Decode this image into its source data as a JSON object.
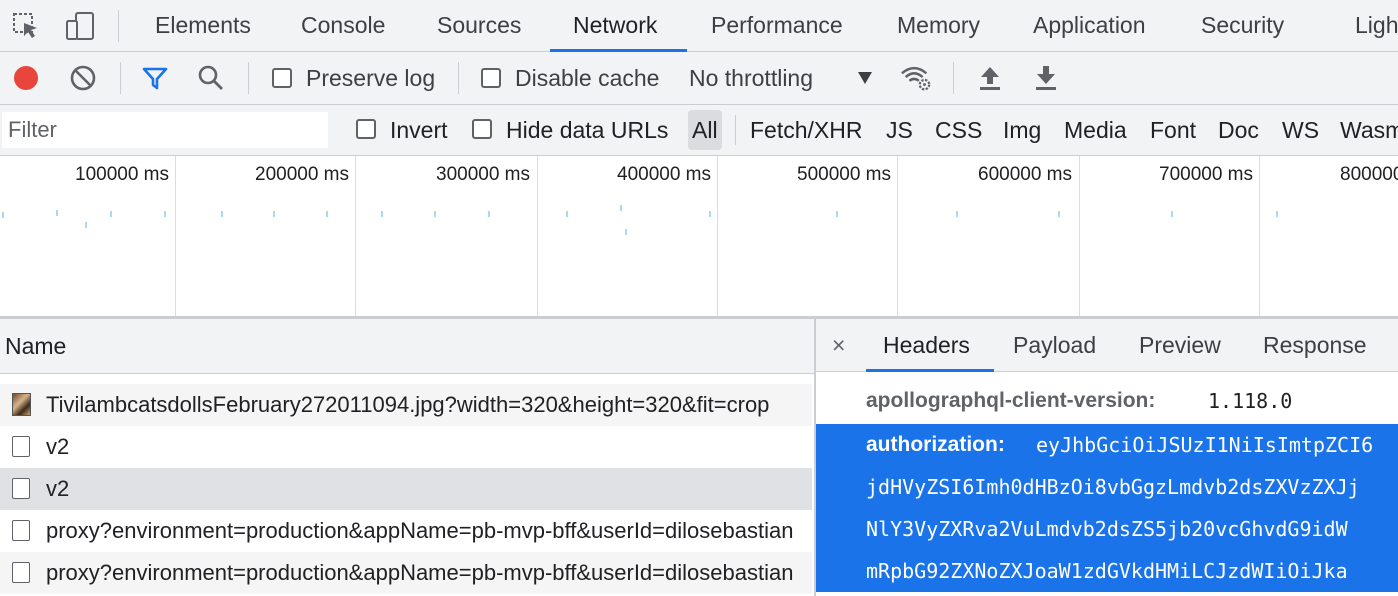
{
  "main_tabs": [
    "Elements",
    "Console",
    "Sources",
    "Network",
    "Performance",
    "Memory",
    "Application",
    "Security",
    "Ligh"
  ],
  "active_main_tab": "Network",
  "toolbar": {
    "preserve_log": "Preserve log",
    "disable_cache": "Disable cache",
    "throttling": "No throttling"
  },
  "filter_bar": {
    "placeholder": "Filter",
    "invert": "Invert",
    "hide_data_urls": "Hide data URLs",
    "types": [
      "All",
      "Fetch/XHR",
      "JS",
      "CSS",
      "Img",
      "Media",
      "Font",
      "Doc",
      "WS",
      "Wasm"
    ],
    "active_type": "All"
  },
  "overview": {
    "labels": [
      "100000 ms",
      "200000 ms",
      "300000 ms",
      "400000 ms",
      "500000 ms",
      "600000 ms",
      "700000 ms",
      "800000"
    ]
  },
  "list": {
    "header": "Name",
    "rows": [
      "TivilambcatsdollsFebruary272011094.jpg?width=320&height=320&fit=crop",
      "v2",
      "v2",
      "proxy?environment=production&appName=pb-mvp-bff&userId=dilosebastian",
      "proxy?environment=production&appName=pb-mvp-bff&userId=dilosebastian"
    ]
  },
  "detail": {
    "close": "×",
    "tabs": [
      "Headers",
      "Payload",
      "Preview",
      "Response"
    ],
    "active_tab": "Headers",
    "header_rows": [
      {
        "key": "apollographql-client-version:",
        "value": "1.118.0"
      },
      {
        "key": "authorization:",
        "value": "eyJhbGciOiJSUzI1NiIsImtpZCI6"
      },
      {
        "key": "",
        "value": "jdHVyZSI6Imh0dHBzOi8vbGgzLmdvb2dsZXVzZXJj"
      },
      {
        "key": "",
        "value": "NlY3VyZXRva2VuLmdvb2dsZS5jb20vcGhvdG9idW"
      },
      {
        "key": "",
        "value": "mRpbG92ZXNoZXJoaW1zdGVkdHMiLCJzdWIiOiJka"
      }
    ]
  },
  "colors": {
    "accent": "#1a73e8",
    "record": "#e8453c",
    "panel_bg": "#f1f3f4"
  }
}
